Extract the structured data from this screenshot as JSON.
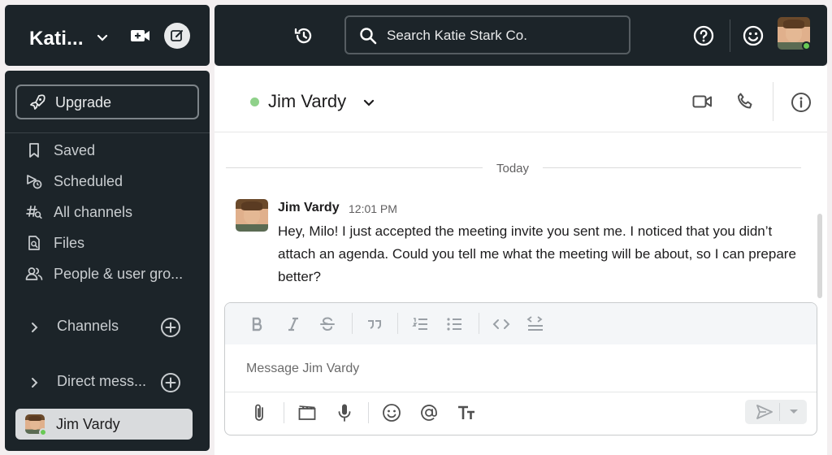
{
  "workspace": {
    "name": "Kati..."
  },
  "topbar": {
    "search_placeholder": "Search Katie Stark Co."
  },
  "sidebar": {
    "upgrade_label": "Upgrade",
    "nav": [
      {
        "label": "Saved",
        "icon": "bookmark-icon"
      },
      {
        "label": "Scheduled",
        "icon": "scheduled-send-icon"
      },
      {
        "label": "All channels",
        "icon": "channel-search-icon"
      },
      {
        "label": "Files",
        "icon": "file-search-icon"
      },
      {
        "label": "People & user gro...",
        "icon": "people-icon"
      }
    ],
    "sections": [
      {
        "label": "Channels"
      },
      {
        "label": "Direct mess..."
      }
    ],
    "dm_active": {
      "label": "Jim Vardy"
    }
  },
  "channel": {
    "name": "Jim Vardy"
  },
  "messages": {
    "date_divider": "Today",
    "items": [
      {
        "author": "Jim Vardy",
        "time": "12:01 PM",
        "text": "Hey, Milo! I just accepted the meeting invite you sent me. I noticed that you didn’t attach an agenda. Could you tell me what the meeting will be about, so I can prepare better?"
      }
    ]
  },
  "composer": {
    "placeholder": "Message Jim Vardy"
  },
  "colors": {
    "sidebar_bg": "#1c2429",
    "presence": "#69c955",
    "accent_text": "#c9cdd0"
  }
}
